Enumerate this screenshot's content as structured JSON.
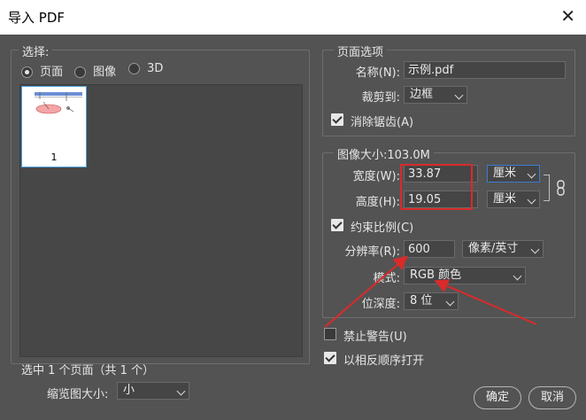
{
  "window": {
    "title": "导入 PDF",
    "close_glyph": "✕"
  },
  "select_panel": {
    "legend": "选择:",
    "radios": [
      {
        "label": "页面",
        "selected": true
      },
      {
        "label": "图像",
        "selected": false
      },
      {
        "label": "3D",
        "selected": false
      }
    ],
    "thumbnail": {
      "page_number": "1"
    },
    "status": "选中 1 个页面（共 1 个）",
    "thumb_size_label": "缩览图大小:",
    "thumb_size_value": "小"
  },
  "page_options": {
    "legend": "页面选项",
    "name_label": "名称(N):",
    "name_value": "示例.pdf",
    "crop_label": "裁剪到:",
    "crop_value": "边框",
    "antialias_label": "消除锯齿(A)",
    "antialias_checked": true
  },
  "image_size": {
    "legend": "图像大小:103.0M",
    "width_label": "宽度(W):",
    "width_value": "33.87",
    "width_unit": "厘米",
    "height_label": "高度(H):",
    "height_value": "19.05",
    "height_unit": "厘米",
    "constrain_label": "约束比例(C)",
    "constrain_checked": true,
    "resolution_label": "分辨率(R):",
    "resolution_value": "600",
    "resolution_unit": "像素/英寸",
    "mode_label": "模式:",
    "mode_value": "RGB 颜色",
    "depth_label": "位深度:",
    "depth_value": "8 位"
  },
  "options": {
    "suppress_warnings_label": "禁止警告(U)",
    "suppress_warnings_checked": false,
    "reverse_order_label": "以相反顺序打开",
    "reverse_order_checked": true
  },
  "buttons": {
    "ok": "确定",
    "cancel": "取消"
  },
  "annotations": {
    "highlight_color": "#d82b2b"
  }
}
